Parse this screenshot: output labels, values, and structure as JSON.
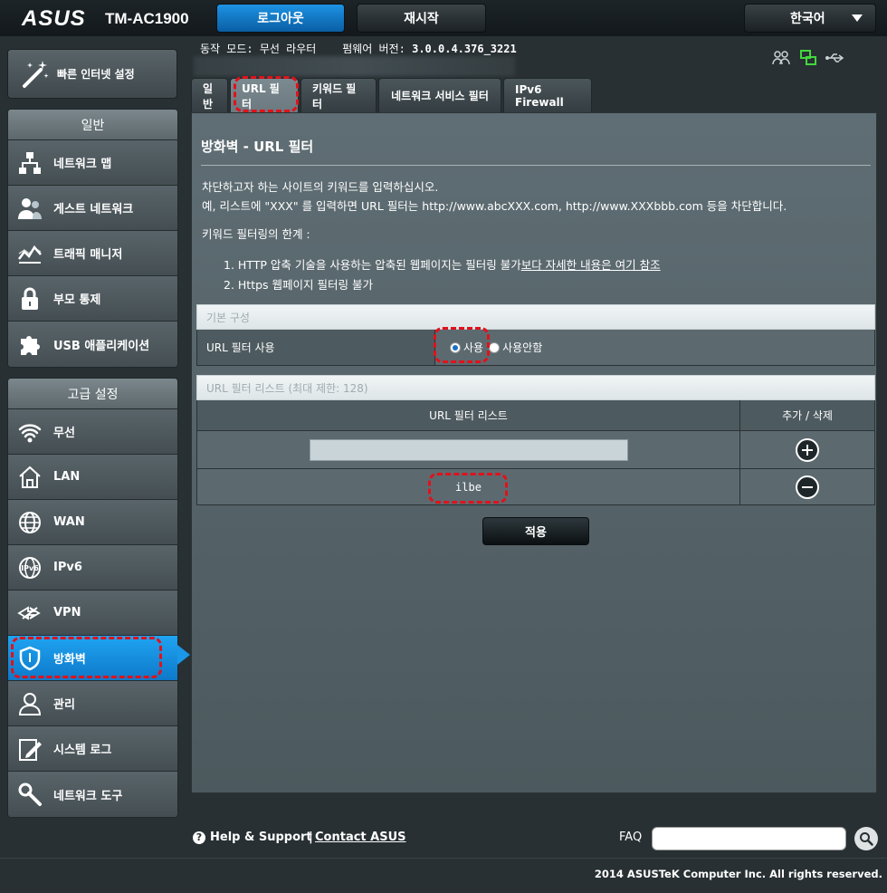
{
  "header": {
    "brand": "ASUS",
    "model": "TM-AC1900",
    "logout_label": "로그아웃",
    "reboot_label": "재시작",
    "language": "한국어"
  },
  "status": {
    "mode_label": "동작 모드:",
    "mode_value": "무선 라우터",
    "firmware_label": "펌웨어 버전:",
    "firmware_value": "3.0.0.4.376_3221"
  },
  "sidebar": {
    "quick_setup": "빠른 인터넷 설정",
    "general_title": "일반",
    "general_items": [
      {
        "label": "네트워크 맵",
        "icon": "network-map-icon"
      },
      {
        "label": "게스트 네트워크",
        "icon": "guest-network-icon"
      },
      {
        "label": "트래픽 매니저",
        "icon": "traffic-manager-icon"
      },
      {
        "label": "부모 통제",
        "icon": "parental-control-icon"
      },
      {
        "label": "USB 애플리케이션",
        "icon": "usb-application-icon"
      }
    ],
    "advanced_title": "고급 설정",
    "advanced_items": [
      {
        "label": "무선",
        "icon": "wireless-icon"
      },
      {
        "label": "LAN",
        "icon": "lan-icon"
      },
      {
        "label": "WAN",
        "icon": "wan-icon"
      },
      {
        "label": "IPv6",
        "icon": "ipv6-icon"
      },
      {
        "label": "VPN",
        "icon": "vpn-icon"
      },
      {
        "label": "방화벽",
        "icon": "firewall-icon"
      },
      {
        "label": "관리",
        "icon": "administration-icon"
      },
      {
        "label": "시스템 로그",
        "icon": "system-log-icon"
      },
      {
        "label": "네트워크 도구",
        "icon": "network-tools-icon"
      }
    ]
  },
  "tabs": [
    {
      "label": "일반"
    },
    {
      "label": "URL 필터"
    },
    {
      "label": "키워드 필터"
    },
    {
      "label": "네트워크 서비스 필터"
    },
    {
      "label": "IPv6 Firewall"
    }
  ],
  "content": {
    "title": "방화벽 - URL 필터",
    "desc1": "차단하고자 하는 사이트의 키워드를 입력하십시오.",
    "desc2": "예, 리스트에 \"XXX\" 를 입력하면 URL 필터는 http://www.abcXXX.com, http://www.XXXbbb.com 등을 차단합니다.",
    "limit_title": "키워드 필터링의 한계 :",
    "limit1": "1. HTTP 압축 기술을 사용하는 압축된 웹페이지는 필터링 불가",
    "limit1_link": "보다 자세한 내용은 여기 참조",
    "limit2": "2. Https 웹페이지 필터링 불가",
    "basic_config": {
      "header": "기본 구성",
      "enable_label": "URL 필터 사용",
      "option_on": "사용",
      "option_off": "사용안함",
      "selected": "사용"
    },
    "url_list": {
      "header": "URL 필터 리스트 (최대 제한: 128)",
      "col_list": "URL 필터 리스트",
      "col_action": "추가 / 삭제",
      "new_value": "",
      "entries": [
        "ilbe"
      ]
    },
    "apply_label": "적용"
  },
  "footer": {
    "help": "Help & Support",
    "separator": "|",
    "contact": "Contact ASUS",
    "faq": "FAQ",
    "faq_value": "",
    "copyright": "2014 ASUSTeK Computer Inc. All rights reserved."
  },
  "colors": {
    "accent": "#1b97e8",
    "highlight": "#e0121b",
    "panel": "#5f6e74"
  }
}
